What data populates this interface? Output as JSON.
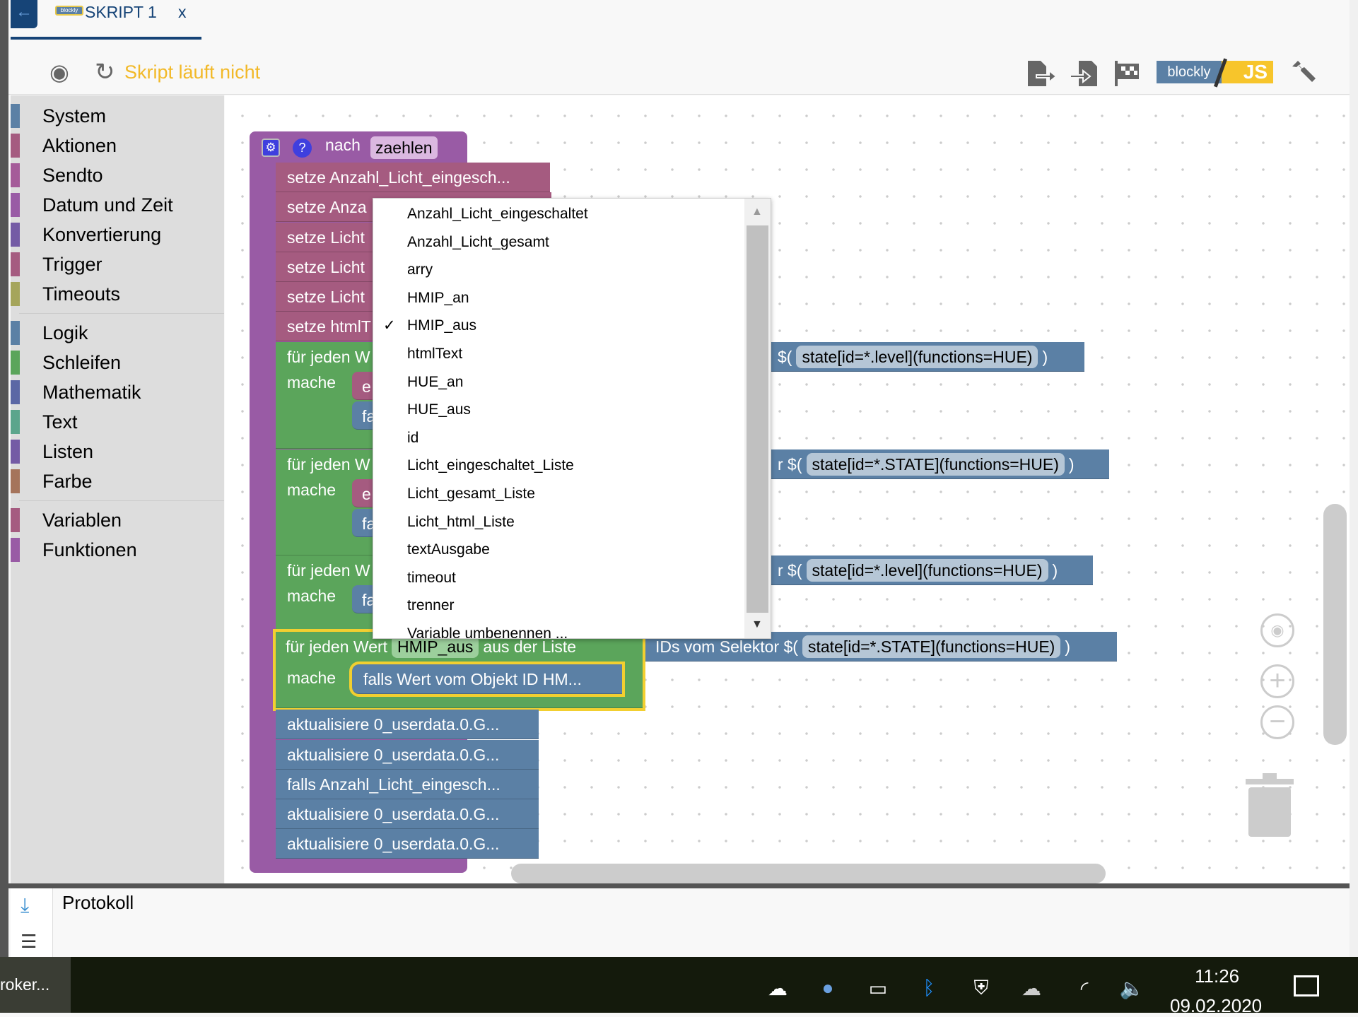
{
  "tab": {
    "title": "SKRIPT 1",
    "close": "x",
    "back_icon": "arrow-left-icon",
    "logo": "blockly"
  },
  "toolbar": {
    "status": "Skript läuft nicht",
    "status_color": "#f2b928",
    "logo_left": "blockly",
    "logo_right": "JS",
    "icons": [
      "target-icon",
      "refresh-icon",
      "export-icon",
      "import-icon",
      "checkered-flag-icon",
      "wrench-icon"
    ]
  },
  "sidebar": {
    "groups": [
      [
        {
          "label": "System",
          "color": "#5b80a5"
        },
        {
          "label": "Aktionen",
          "color": "#a55b80"
        },
        {
          "label": "Sendto",
          "color": "#a55b99"
        },
        {
          "label": "Datum und Zeit",
          "color": "#995ba5"
        },
        {
          "label": "Konvertierung",
          "color": "#745ba5"
        },
        {
          "label": "Trigger",
          "color": "#a55b80"
        },
        {
          "label": "Timeouts",
          "color": "#a5a55b"
        }
      ],
      [
        {
          "label": "Logik",
          "color": "#5b80a5"
        },
        {
          "label": "Schleifen",
          "color": "#5ba55b"
        },
        {
          "label": "Mathematik",
          "color": "#5b67a5"
        },
        {
          "label": "Text",
          "color": "#5ba58c"
        },
        {
          "label": "Listen",
          "color": "#745ba5"
        },
        {
          "label": "Farbe",
          "color": "#a5745b"
        }
      ],
      [
        {
          "label": "Variablen",
          "color": "#a55b80"
        },
        {
          "label": "Funktionen",
          "color": "#995ba5"
        }
      ]
    ]
  },
  "workspace": {
    "function": {
      "keyword": "nach",
      "name": "zaehlen"
    },
    "setze": [
      "setze Anzahl_Licht_eingesch...",
      "setze Anza",
      "setze Licht",
      "setze Licht",
      "setze Licht",
      "setze htmlT"
    ],
    "loops": [
      {
        "head": "für jeden W",
        "mache": "mache",
        "inner": [
          "e",
          "fa"
        ],
        "sel_prefix": "$(",
        "selector": "state[id=*.level](functions=HUE)",
        "close": ")"
      },
      {
        "head": "für jeden W",
        "mache": "mache",
        "inner": [
          "e",
          "fa"
        ],
        "sel_prefix": "r $(",
        "selector": "state[id=*.STATE](functions=HUE)",
        "close": ")"
      },
      {
        "head": "für jeden W",
        "mache": "mache",
        "inner": [
          "fa"
        ],
        "sel_prefix": "r $(",
        "selector": "state[id=*.level](functions=HUE)",
        "close": ")"
      }
    ],
    "selected_loop": {
      "head": "für jeden Wert",
      "var": "HMIP_aus",
      "from": "aus der Liste",
      "sel_prefix": "IDs vom Selektor $(",
      "selector": "state[id=*.STATE](functions=HUE)",
      "close": ")",
      "mache": "mache",
      "inner": "falls Wert vom Objekt ID HM..."
    },
    "after": [
      "aktualisiere 0_userdata.0.G...",
      "aktualisiere 0_userdata.0.G...",
      "falls Anzahl_Licht_eingesch...",
      "aktualisiere 0_userdata.0.G...",
      "aktualisiere 0_userdata.0.G..."
    ]
  },
  "dropdown": {
    "items": [
      "Anzahl_Licht_eingeschaltet",
      "Anzahl_Licht_gesamt",
      "arry",
      "HMIP_an",
      "HMIP_aus",
      "htmlText",
      "HUE_an",
      "HUE_aus",
      "id",
      "Licht_eingeschaltet_Liste",
      "Licht_gesamt_Liste",
      "Licht_html_Liste",
      "textAusgabe",
      "timeout",
      "trenner",
      "Variable umbenennen ..."
    ],
    "selected": "HMIP_aus",
    "check": "✓"
  },
  "log": {
    "title": "Protokoll"
  },
  "taskbar": {
    "app": "roker...",
    "time": "11:26",
    "date": "09.02.2020"
  }
}
